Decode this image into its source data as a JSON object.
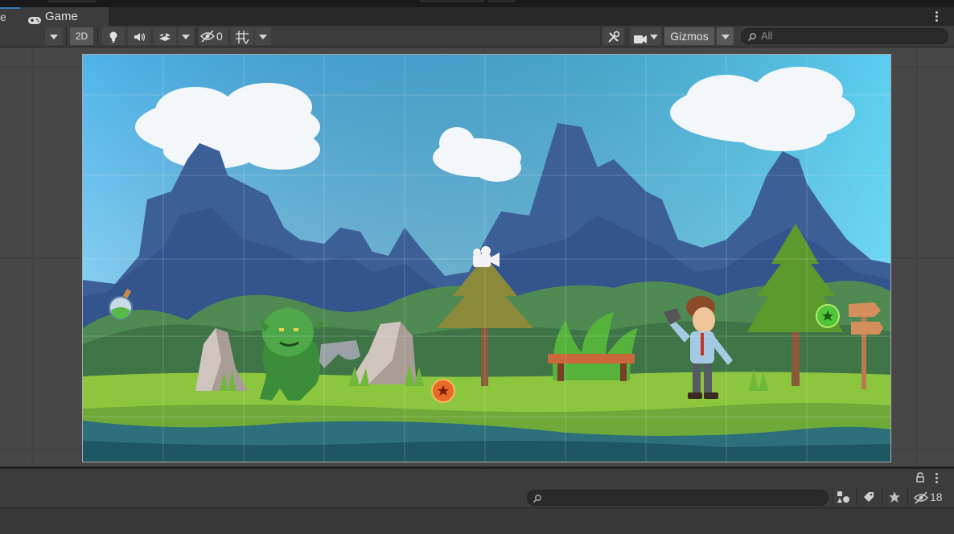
{
  "tabs": {
    "previous_tab_fragment": "e",
    "game_tab_label": "Game"
  },
  "scene_toolbar": {
    "mode_2d_label": "2D",
    "hidden_count": "0",
    "gizmos_label": "Gizmos",
    "search_placeholder": "All"
  },
  "project_toolbar": {
    "search_placeholder": "",
    "hidden_count": "18"
  },
  "colors": {
    "panel_bg": "#3c3c3c",
    "toolbar_button": "#585858",
    "scene_bg": "#474747",
    "sky_top": "#5ab7ea",
    "sky_bottom": "#a8d9f4",
    "grass": "#8cc63f",
    "water": "#2d6f7a"
  },
  "icons": [
    "gamepad-icon",
    "kebab-menu-icon",
    "lightbulb-icon",
    "audio-icon",
    "effects-icon",
    "visibility-off-icon",
    "grid-icon",
    "tools-icon",
    "camera-icon",
    "search-icon",
    "lock-icon",
    "asset-type-filter-icon",
    "label-filter-icon",
    "star-icon"
  ]
}
